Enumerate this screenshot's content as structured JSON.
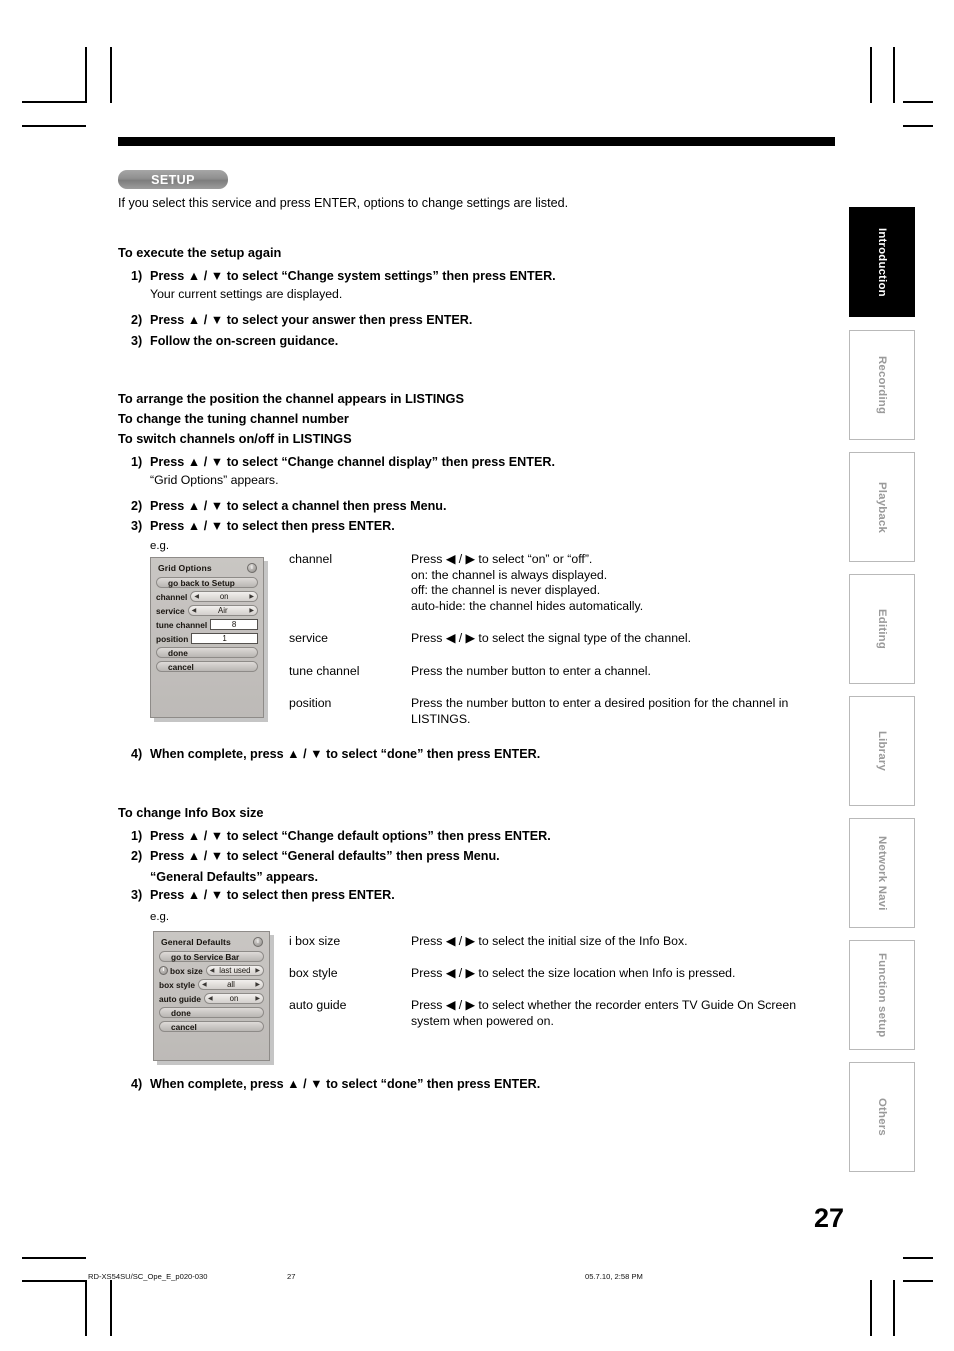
{
  "badge": {
    "label": "SETUP"
  },
  "intro": "If you select this service and press ENTER, options to change settings are listed.",
  "section1": {
    "heading": "To execute the setup again",
    "steps": [
      {
        "num": "1)",
        "text": "Press ▲ / ▼ to select “Change system settings” then press ENTER."
      },
      {
        "num": "2)",
        "text": "Press ▲ / ▼ to select your answer then press ENTER."
      },
      {
        "num": "3)",
        "text": "Follow the on-screen guidance."
      }
    ],
    "note": "Your current settings are displayed."
  },
  "section2": {
    "headings": [
      "To arrange the position the channel appears in LISTINGS",
      "To change the tuning channel number",
      "To switch channels on/off in LISTINGS"
    ],
    "steps": [
      {
        "num": "1)",
        "text": "Press ▲ / ▼ to select “Change channel display” then press ENTER."
      },
      {
        "num": "2)",
        "text": "Press ▲ / ▼ to select a channel then press Menu."
      },
      {
        "num": "3)",
        "text": "Press ▲ / ▼ to select then press ENTER."
      },
      {
        "num": "4)",
        "text": "When complete, press ▲ / ▼ to select “done” then press ENTER."
      }
    ],
    "note": "“Grid Options” appears.",
    "eg": "e.g.",
    "descriptions": [
      {
        "term": "channel",
        "desc": "Press ◀ / ▶ to select “on” or “off”.\non: the channel is always displayed.\noff: the channel is never displayed.\nauto-hide: the channel hides automatically."
      },
      {
        "term": "service",
        "desc": "Press ◀ / ▶ to select the signal type of the channel."
      },
      {
        "term": "tune channel",
        "desc": "Press the number button to enter a channel."
      },
      {
        "term": "position",
        "desc": "Press the number button to enter a desired position for the channel in LISTINGS."
      }
    ]
  },
  "grid_options": {
    "title": "Grid Options",
    "info_icon": "i",
    "go_back": "go back to Setup",
    "rows": [
      {
        "label": "channel",
        "value": "on",
        "kind": "spinner"
      },
      {
        "label": "service",
        "value": "Air",
        "kind": "spinner"
      },
      {
        "label": "tune channel",
        "value": "8",
        "kind": "field"
      },
      {
        "label": "position",
        "value": "1",
        "kind": "field"
      }
    ],
    "done": "done",
    "cancel": "cancel"
  },
  "section3": {
    "heading": "To change Info Box size",
    "steps": [
      {
        "num": "1)",
        "text": "Press ▲ / ▼ to select “Change default options” then press ENTER."
      },
      {
        "num": "2)",
        "text": "Press ▲ / ▼ to select “General defaults” then press Menu."
      },
      {
        "num": "3)",
        "text": "Press ▲ / ▼ to select then press ENTER."
      },
      {
        "num": "4)",
        "text": "When complete, press ▲ / ▼ to select “done” then press ENTER."
      }
    ],
    "note": "“General Defaults” appears.",
    "eg": "e.g.",
    "descriptions": [
      {
        "term": "i box size",
        "desc": "Press ◀ / ▶ to select the initial size of the Info Box."
      },
      {
        "term": "box style",
        "desc": "Press ◀ / ▶ to select the size location when Info is pressed."
      },
      {
        "term": "auto guide",
        "desc": "Press ◀ / ▶ to select whether the recorder enters TV Guide On Screen system when powered on."
      }
    ]
  },
  "general_defaults": {
    "title": "General Defaults",
    "info_icon": "i",
    "go_back": "go to Service Bar",
    "rows": [
      {
        "label": "box size",
        "value": "last used",
        "has_icon": true
      },
      {
        "label": "box style",
        "value": "all",
        "has_icon": false
      },
      {
        "label": "auto guide",
        "value": "on",
        "has_icon": false
      }
    ],
    "done": "done",
    "cancel": "cancel"
  },
  "side_tabs": [
    {
      "label": "Introduction",
      "active": true
    },
    {
      "label": "Recording",
      "active": false
    },
    {
      "label": "Playback",
      "active": false
    },
    {
      "label": "Editing",
      "active": false
    },
    {
      "label": "Library",
      "active": false
    },
    {
      "label": "Network Navi",
      "active": false
    },
    {
      "label": "Function setup",
      "active": false
    },
    {
      "label": "Others",
      "active": false
    }
  ],
  "page_number": "27",
  "footer": {
    "file": "RD-XS54SU/SC_Ope_E_p020-030",
    "page": "27",
    "timestamp": "05.7.10, 2:58 PM"
  }
}
